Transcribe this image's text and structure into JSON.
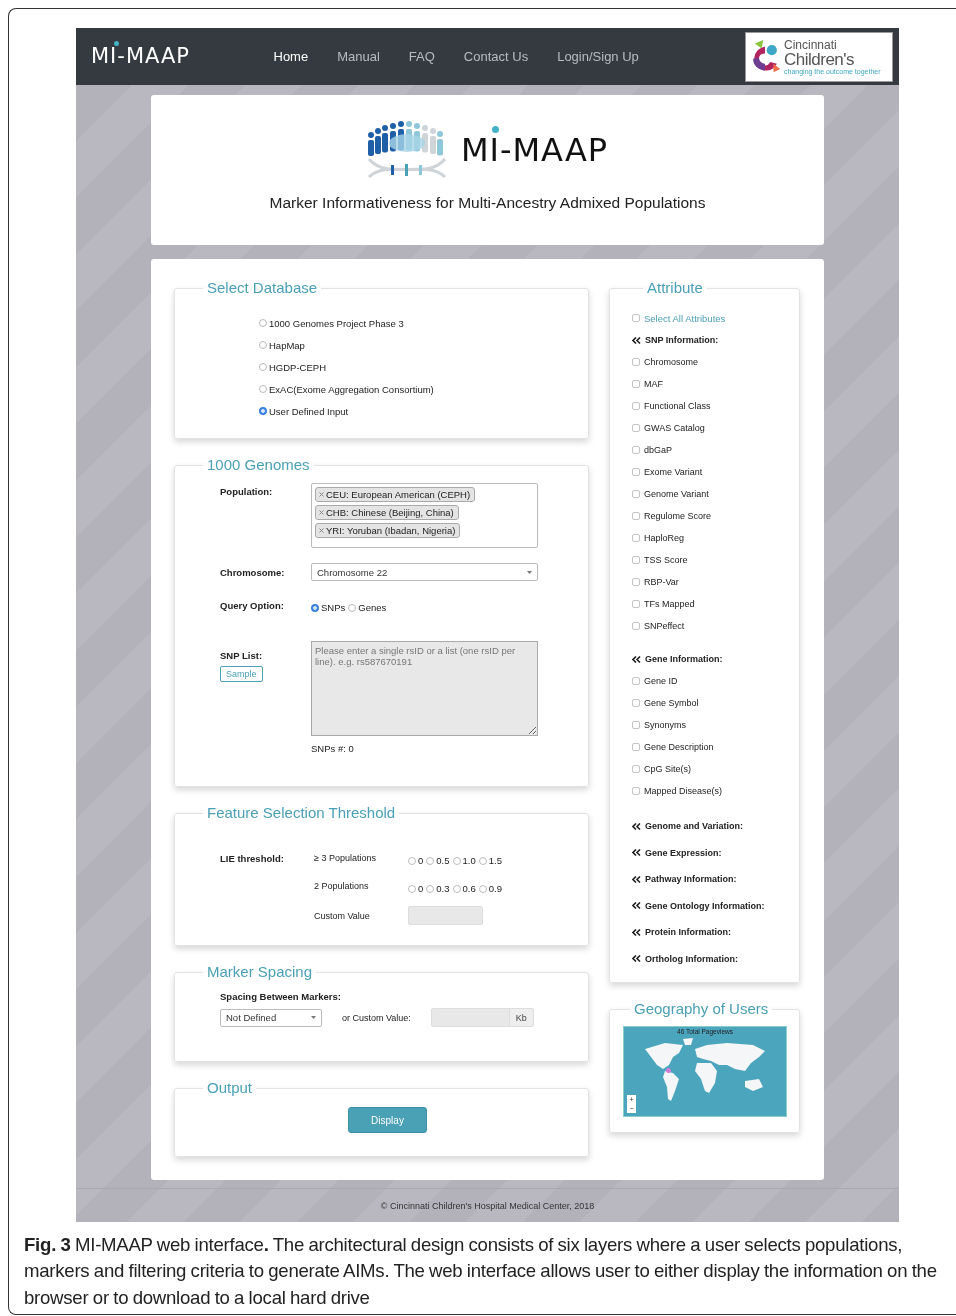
{
  "nav": {
    "brand": "MI-MAAP",
    "links": [
      {
        "label": "Home",
        "selected": true
      },
      {
        "label": "Manual",
        "selected": false
      },
      {
        "label": "FAQ",
        "selected": false
      },
      {
        "label": "Contact Us",
        "selected": false
      },
      {
        "label": "Login/Sign Up",
        "selected": false
      }
    ],
    "partner": {
      "line1": "Cincinnati",
      "line2": "Children's",
      "tagline": "changing the outcome together"
    }
  },
  "hero": {
    "title": "MI-MAAP",
    "subtitle": "Marker Informativeness for Multi-Ancestry Admixed Populations"
  },
  "select_database": {
    "title": "Select Database",
    "options": [
      {
        "label": "1000 Genomes Project Phase 3",
        "selected": false
      },
      {
        "label": "HapMap",
        "selected": false
      },
      {
        "label": "HGDP-CEPH",
        "selected": false
      },
      {
        "label": "ExAC(Exome Aggregation Consortium)",
        "selected": false
      },
      {
        "label": "User Defined Input",
        "selected": true
      }
    ]
  },
  "genomes": {
    "title": "1000 Genomes",
    "population_label": "Population:",
    "populations": [
      "CEU: European American (CEPH)",
      "CHB: Chinese (Beijing, China)",
      "YRI: Yoruban (Ibadan, Nigeria)"
    ],
    "chromosome_label": "Chromosome:",
    "chromosome": "Chromosome 22",
    "query_label": "Query Option:",
    "query_options": [
      {
        "label": "SNPs",
        "selected": true
      },
      {
        "label": "Genes",
        "selected": false
      }
    ],
    "snp_list_label": "SNP List:",
    "sample_button": "Sample",
    "snp_placeholder": "Please enter a single rsID or a list (one rsID per line). e.g. rs587670191",
    "snp_count": "SNPs #: 0"
  },
  "threshold": {
    "title": "Feature Selection Threshold",
    "label": "LIE threshold:",
    "rows": [
      {
        "label": "≥ 3 Populations",
        "options": [
          {
            "label": "0",
            "selected": false
          },
          {
            "label": "0.5",
            "selected": false
          },
          {
            "label": "1.0",
            "selected": false
          },
          {
            "label": "1.5",
            "selected": false
          }
        ]
      },
      {
        "label": "2 Populations",
        "options": [
          {
            "label": "0",
            "selected": false
          },
          {
            "label": "0.3",
            "selected": false
          },
          {
            "label": "0.6",
            "selected": false
          },
          {
            "label": "0.9",
            "selected": false
          }
        ]
      }
    ],
    "custom_label": "Custom Value"
  },
  "spacing": {
    "title": "Marker Spacing",
    "label": "Spacing Between Markers:",
    "select": "Not Defined",
    "custom_label": "or Custom Value:",
    "unit": "Kb"
  },
  "output": {
    "title": "Output",
    "button": "Display"
  },
  "attribute": {
    "title": "Attribute",
    "select_all": {
      "label": "Select All Attributes",
      "checked": false
    },
    "groups": [
      {
        "title": "SNP Information:",
        "items": [
          {
            "label": "Chromosome",
            "checked": false
          },
          {
            "label": "MAF",
            "checked": false
          },
          {
            "label": "Functional Class",
            "checked": false
          },
          {
            "label": "GWAS Catalog",
            "checked": false
          },
          {
            "label": "dbGaP",
            "checked": false
          },
          {
            "label": "Exome Variant",
            "checked": false
          },
          {
            "label": "Genome Variant",
            "checked": false
          },
          {
            "label": "Regulome Score",
            "checked": false
          },
          {
            "label": "HaploReg",
            "checked": false
          },
          {
            "label": "TSS Score",
            "checked": false
          },
          {
            "label": "RBP-Var",
            "checked": false
          },
          {
            "label": "TFs Mapped",
            "checked": false
          },
          {
            "label": "SNPeffect",
            "checked": false
          }
        ]
      },
      {
        "title": "Gene Information:",
        "items": [
          {
            "label": "Gene ID",
            "checked": false
          },
          {
            "label": "Gene Symbol",
            "checked": false
          },
          {
            "label": "Synonyms",
            "checked": false
          },
          {
            "label": "Gene Description",
            "checked": false
          },
          {
            "label": "CpG Site(s)",
            "checked": false
          },
          {
            "label": "Mapped Disease(s)",
            "checked": false
          }
        ]
      },
      {
        "title": "Genome and Variation:"
      },
      {
        "title": "Gene Expression:"
      },
      {
        "title": "Pathway Information:"
      },
      {
        "title": "Gene Ontology Information:"
      },
      {
        "title": "Protein Information:"
      },
      {
        "title": "Ortholog Information:"
      }
    ]
  },
  "geography": {
    "title": "Geography of Users",
    "pageviews": "46 Total Pageviews",
    "zoom_in": "+",
    "zoom_out": "−"
  },
  "footer": "© Cincinnati Children's Hospital Medical Center, 2018",
  "caption": "**Fig. 3** MI-MAAP web interface**.** The architectural design consists of six layers where a user selects populations, markers and filtering criteria to generate AIMs. The web interface allows user to either display the information on the browser or to download to a local hard drive"
}
